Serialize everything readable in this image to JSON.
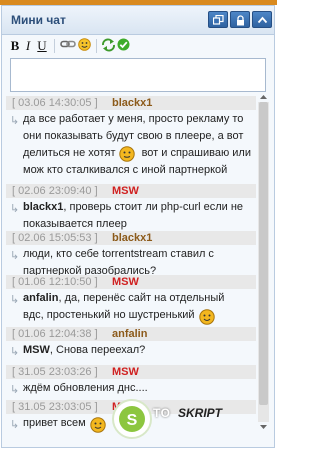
{
  "chat": {
    "title": "Мини чат",
    "toolbar": {
      "bold": "B",
      "italic": "I",
      "underline": "U"
    },
    "messages": [
      {
        "time": "[ 03.06 14:30:05 ]",
        "user": "blackx1",
        "user_color": "#8c5a1a",
        "lines": [
          "да все работает у меня, просто рекламу то",
          "они показывать будут свою в плеере, а вот",
          "делиться не хотят",
          "вот и спрашиваю или",
          "мож кто сталкивался с иной партнеркой"
        ]
      },
      {
        "time": "[ 02.06 23:09:40 ]",
        "user": "MSW",
        "user_color": "#d02020",
        "lines": [
          "blackx1",
          ", проверь стоит ли php-curl если не",
          "показывается плеер"
        ]
      },
      {
        "time": "[ 02.06 15:05:53 ]",
        "user": "blackx1",
        "user_color": "#8c5a1a",
        "lines": [
          "люди, кто себе torrentstream ставил с",
          "партнеркой разобрались?"
        ]
      },
      {
        "time": "[ 01.06 12:10:50 ]",
        "user": "MSW",
        "user_color": "#d02020",
        "lines": [
          "anfalin",
          ", да, перенёс сайт на отдельный",
          "вдс, простенький но шустренький"
        ]
      },
      {
        "time": "[ 01.06 12:04:38 ]",
        "user": "anfalin",
        "user_color": "#8c5a1a",
        "lines": [
          "MSW",
          ", Снова переехал?"
        ]
      },
      {
        "time": "[ 31.05 23:03:26 ]",
        "user": "MSW",
        "user_color": "#d02020",
        "lines": [
          "ждём обновления днс...."
        ]
      },
      {
        "time": "[ 31.05 23:03:05 ]",
        "user": "MSW",
        "user_color": "#d02020",
        "lines": [
          "привет всем"
        ]
      }
    ],
    "watermark": {
      "part1": "TO",
      "part2": "SKRIPT"
    }
  }
}
